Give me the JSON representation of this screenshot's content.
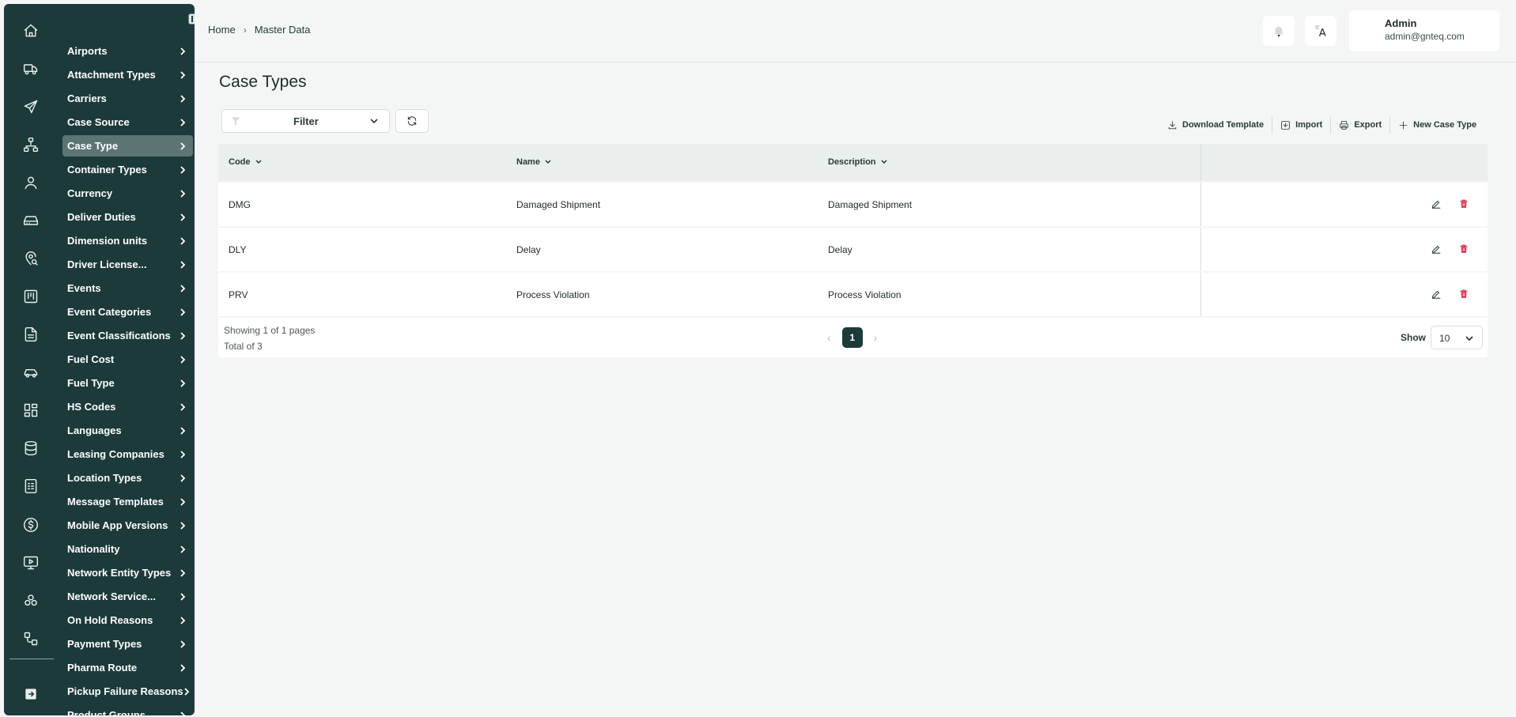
{
  "sidebar": {
    "rail_icons": [
      "home-icon",
      "truck-icon",
      "plane-icon",
      "network-icon",
      "user-icon",
      "drive-icon",
      "location-search-icon",
      "kanban-icon",
      "document-icon",
      "car-icon",
      "grid-icon",
      "database-icon",
      "report-icon",
      "dollar-icon",
      "monitor-play-icon",
      "cluster-icon",
      "workflow-icon",
      "logout-icon"
    ],
    "items": [
      {
        "label": "Airports"
      },
      {
        "label": "Attachment Types"
      },
      {
        "label": "Carriers"
      },
      {
        "label": "Case Source"
      },
      {
        "label": "Case Type",
        "active": true
      },
      {
        "label": "Container Types"
      },
      {
        "label": "Currency"
      },
      {
        "label": "Deliver Duties"
      },
      {
        "label": "Dimension units"
      },
      {
        "label": "Driver License..."
      },
      {
        "label": "Events"
      },
      {
        "label": "Event Categories"
      },
      {
        "label": "Event Classifications"
      },
      {
        "label": "Fuel Cost"
      },
      {
        "label": "Fuel Type"
      },
      {
        "label": "HS Codes"
      },
      {
        "label": "Languages"
      },
      {
        "label": "Leasing Companies"
      },
      {
        "label": "Location Types"
      },
      {
        "label": "Message Templates"
      },
      {
        "label": "Mobile App Versions"
      },
      {
        "label": "Nationality"
      },
      {
        "label": "Network Entity Types"
      },
      {
        "label": "Network Service..."
      },
      {
        "label": "On Hold Reasons"
      },
      {
        "label": "Payment Types"
      },
      {
        "label": "Pharma Route"
      },
      {
        "label": "Pickup Failure Reasons"
      },
      {
        "label": "Product Groups"
      }
    ]
  },
  "header": {
    "breadcrumb": {
      "home": "Home",
      "current": "Master Data"
    },
    "user": {
      "name": "Admin",
      "email": "admin@gnteq.com"
    }
  },
  "page": {
    "title": "Case Types",
    "filter_label": "Filter",
    "actions": {
      "download_template": "Download Template",
      "import": "Import",
      "export": "Export",
      "new": "New Case Type"
    }
  },
  "table": {
    "columns": {
      "code": "Code",
      "name": "Name",
      "description": "Description"
    },
    "rows": [
      {
        "code": "DMG",
        "name": "Damaged Shipment",
        "description": "Damaged Shipment"
      },
      {
        "code": "DLY",
        "name": "Delay",
        "description": "Delay"
      },
      {
        "code": "PRV",
        "name": "Process Violation",
        "description": "Process Violation"
      }
    ],
    "footer": {
      "showing": "Showing 1 of 1 pages",
      "total": "Total of 3",
      "current_page": "1",
      "show_label": "Show",
      "page_size": "10"
    }
  },
  "colors": {
    "sidebar": "#1d3a3a",
    "active_item": "#5c7574",
    "delete": "#e0324b"
  }
}
